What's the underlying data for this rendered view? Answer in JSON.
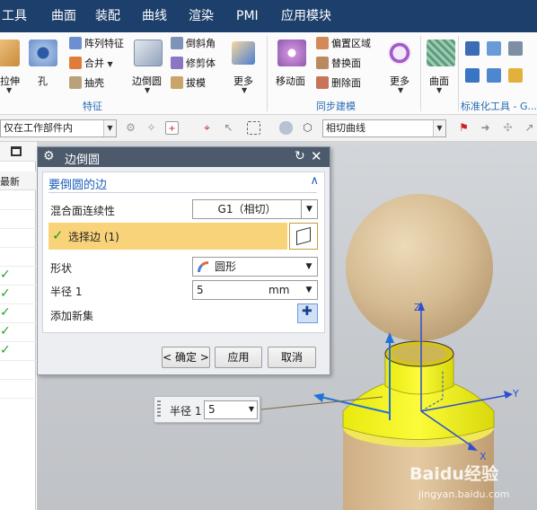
{
  "menubar": {
    "items": [
      "工具",
      "曲面",
      "装配",
      "曲线",
      "渲染",
      "PMI",
      "应用模块"
    ]
  },
  "ribbon": {
    "extrude_label": "拉伸",
    "hole_label": "孔",
    "pattern_feature_label": "阵列特征",
    "unite_label": "合并",
    "shell_label": "抽壳",
    "edge_blend_label": "边倒圆",
    "chamfer_label": "倒斜角",
    "trim_body_label": "修剪体",
    "draft_label": "拔模",
    "more_label_1": "更多",
    "group_feature": "特征",
    "move_face_label": "移动面",
    "offset_region_label": "偏置区域",
    "replace_face_label": "替换面",
    "delete_face_label": "删除面",
    "more_label_2": "更多",
    "group_sync": "同步建模",
    "surface_label": "曲面",
    "group_standard": "标准化工具 - G..."
  },
  "toolbar": {
    "scope_value": "仅在工作部件内",
    "curve_rule_value": "相切曲线"
  },
  "navigator": {
    "latest_label": "最新",
    "checked_rows": 5
  },
  "dialog": {
    "title": "边倒圆",
    "section_title": "要倒圆的边",
    "blend_continuity_label": "混合面连续性",
    "blend_continuity_value": "G1（相切）",
    "select_edge_label": "选择边 (1)",
    "shape_label": "形状",
    "shape_value": "圆形",
    "radius_label": "半径 1",
    "radius_value": "5",
    "radius_unit": "mm",
    "add_new_set_label": "添加新集",
    "ok_label": "< 确定 >",
    "apply_label": "应用",
    "cancel_label": "取消"
  },
  "onscreen_input": {
    "label": "半径 1",
    "value": "5"
  },
  "viewport": {
    "axis_z": "Z",
    "axis_y": "Y",
    "axis_x": "X",
    "watermark_brand": "Baidu经验",
    "watermark_url": "jingyan.baidu.com"
  },
  "colors": {
    "menubar_bg": "#1d3f6b",
    "selection_bar": "#f9d37a",
    "highlight_yellow": "#f2f213",
    "group_label_blue": "#2a6cb3"
  }
}
